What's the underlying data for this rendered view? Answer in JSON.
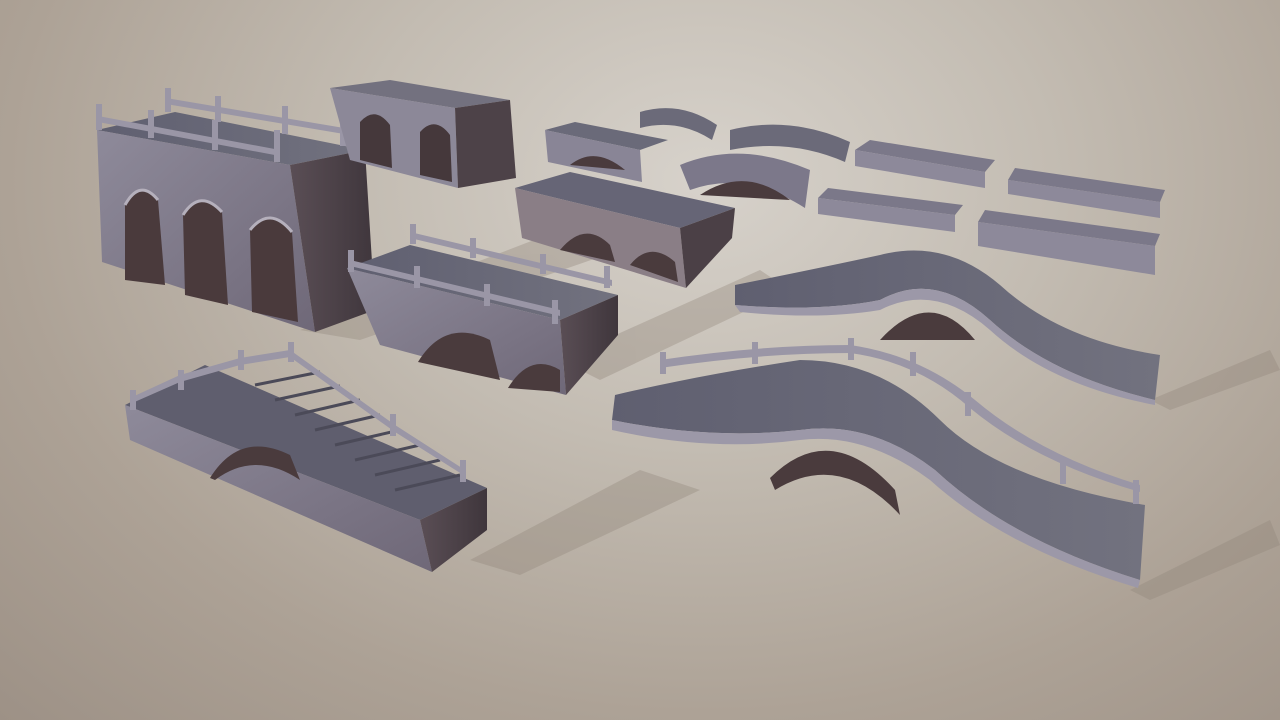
{
  "scene": {
    "subject": "bridge-asset-collection",
    "colors": {
      "background_light": "#d7d2cb",
      "background_dark": "#9d9186",
      "stone_top": "#6e6d7d",
      "stone_side": "#8a8696",
      "stone_dark": "#4e4750",
      "railing": "#9c97a4",
      "shadow": "#8b8076"
    }
  }
}
